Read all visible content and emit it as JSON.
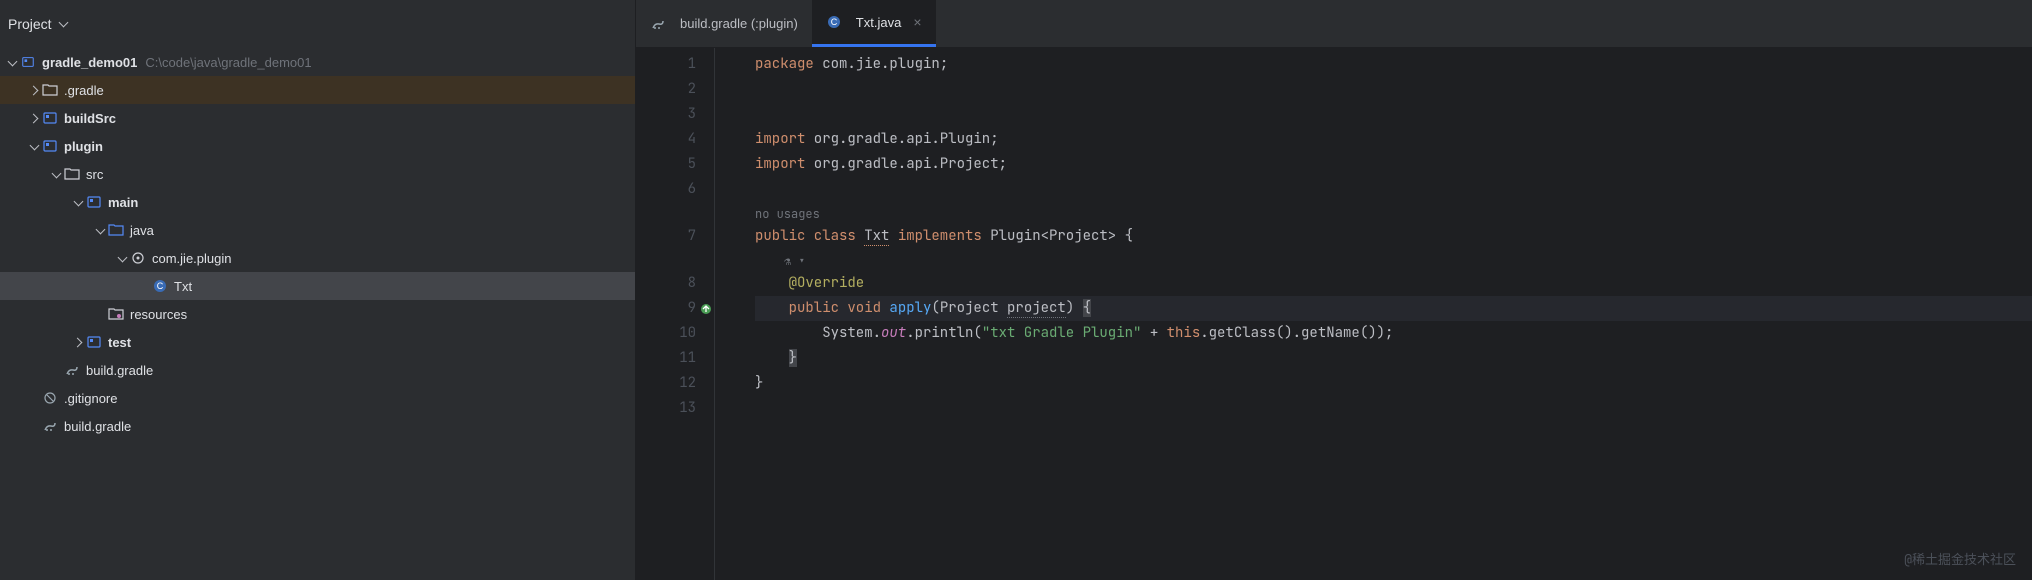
{
  "sidebar": {
    "title": "Project",
    "root": {
      "name": "gradle_demo01",
      "path": "C:\\code\\java\\gradle_demo01"
    },
    "items": [
      {
        "label": ".gradle",
        "depth": 1,
        "arrow": "collapsed",
        "icon": "folder",
        "bold": false,
        "highlighted": true
      },
      {
        "label": "buildSrc",
        "depth": 1,
        "arrow": "collapsed",
        "icon": "module",
        "bold": true
      },
      {
        "label": "plugin",
        "depth": 1,
        "arrow": "expanded",
        "icon": "module",
        "bold": true
      },
      {
        "label": "src",
        "depth": 2,
        "arrow": "expanded",
        "icon": "folder",
        "bold": false
      },
      {
        "label": "main",
        "depth": 3,
        "arrow": "expanded",
        "icon": "module",
        "bold": true
      },
      {
        "label": "java",
        "depth": 4,
        "arrow": "expanded",
        "icon": "source-folder",
        "bold": false
      },
      {
        "label": "com.jie.plugin",
        "depth": 5,
        "arrow": "expanded",
        "icon": "package",
        "bold": false
      },
      {
        "label": "Txt",
        "depth": 6,
        "arrow": "none",
        "icon": "class",
        "bold": false,
        "selected": true
      },
      {
        "label": "resources",
        "depth": 4,
        "arrow": "none",
        "icon": "resource-folder",
        "bold": false
      },
      {
        "label": "test",
        "depth": 3,
        "arrow": "collapsed",
        "icon": "module",
        "bold": true
      },
      {
        "label": "build.gradle",
        "depth": 2,
        "arrow": "none",
        "icon": "gradle",
        "bold": false
      },
      {
        "label": ".gitignore",
        "depth": 1,
        "arrow": "none",
        "icon": "ignore",
        "bold": false
      },
      {
        "label": "build.gradle",
        "depth": 1,
        "arrow": "none",
        "icon": "gradle",
        "bold": false
      }
    ]
  },
  "tabs": [
    {
      "label": "build.gradle (:plugin)",
      "icon": "gradle",
      "active": false
    },
    {
      "label": "Txt.java",
      "icon": "class",
      "active": true
    }
  ],
  "code": {
    "lines": [
      {
        "n": 1,
        "tokens": [
          [
            "kw",
            "package"
          ],
          [
            "",
            ""
          ],
          [
            "pkg",
            " com.jie.plugin"
          ],
          [
            "",
            ";"
          ]
        ]
      },
      {
        "n": 2,
        "tokens": []
      },
      {
        "n": 3,
        "tokens": []
      },
      {
        "n": 4,
        "tokens": [
          [
            "kw",
            "import"
          ],
          [
            "",
            ""
          ],
          [
            "pkg",
            " org.gradle.api.Plugin"
          ],
          [
            "",
            ";"
          ]
        ]
      },
      {
        "n": 5,
        "tokens": [
          [
            "kw",
            "import"
          ],
          [
            "",
            ""
          ],
          [
            "pkg",
            " org.gradle.api.Project"
          ],
          [
            "",
            ";"
          ]
        ]
      },
      {
        "n": 6,
        "tokens": []
      },
      {
        "inlay": "no usages"
      },
      {
        "n": 7,
        "tokens": [
          [
            "kw",
            "public class "
          ],
          [
            "cls-decl",
            "Txt"
          ],
          [
            "",
            " "
          ],
          [
            "kw",
            "implements"
          ],
          [
            "",
            " Plugin<Project> {"
          ]
        ]
      },
      {
        "inlay_icon": true
      },
      {
        "n": 8,
        "tokens": [
          [
            "",
            "    "
          ],
          [
            "ann",
            "@Override"
          ]
        ]
      },
      {
        "n": 9,
        "gutter_icon": "override",
        "cursor": true,
        "tokens": [
          [
            "",
            "    "
          ],
          [
            "kw",
            "public void "
          ],
          [
            "method",
            "apply"
          ],
          [
            "",
            "(Project "
          ],
          [
            "param",
            "project"
          ],
          [
            "",
            ") "
          ],
          [
            "brace-hl",
            "{"
          ]
        ]
      },
      {
        "n": 10,
        "tokens": [
          [
            "",
            "        System."
          ],
          [
            "field",
            "out"
          ],
          [
            "",
            ".println("
          ],
          [
            "str",
            "\"txt Gradle Plugin\""
          ],
          [
            "",
            " + "
          ],
          [
            "kw",
            "this"
          ],
          [
            "",
            ".getClass().getName());"
          ]
        ]
      },
      {
        "n": 11,
        "tokens": [
          [
            "",
            "    "
          ],
          [
            "brace-hl",
            "}"
          ]
        ]
      },
      {
        "n": 12,
        "tokens": [
          [
            "",
            "}"
          ]
        ]
      },
      {
        "n": 13,
        "tokens": []
      }
    ]
  },
  "watermark": "@稀土掘金技术社区"
}
